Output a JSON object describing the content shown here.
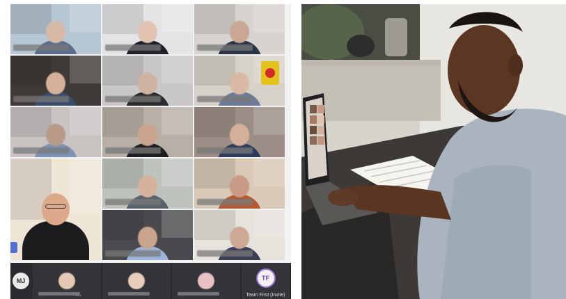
{
  "call": {
    "participants_bar": {
      "mj_initials": "MJ",
      "more_indicator": "...",
      "invited_initials": "TF",
      "invited_label": "Team First (Invite)"
    }
  },
  "colors": {
    "bar_background": "#2b2b2f",
    "invite_ring": "#8f6fd1"
  },
  "tiles": [
    {
      "bg": "#b7c6d3",
      "skin": "#d7b9a8",
      "shirt": "#5a6d8a"
    },
    {
      "bg": "#e4e3e6",
      "skin": "#e2c2b0",
      "shirt": "#1f1f26"
    },
    {
      "bg": "#d7d4cf",
      "skin": "#c9a793",
      "shirt": "#2b3446"
    },
    {
      "bg": "#3e3a37",
      "skin": "#d6b199",
      "shirt": "#3b4b6a"
    },
    {
      "bg": "#c9c7c8",
      "skin": "#cfb3a2",
      "shirt": "#2c2c30"
    },
    {
      "bg": "#d7d2c9",
      "skin": "#d8b9a4",
      "shirt": "#6e7c9a"
    },
    {
      "bg": "#c9c3c2",
      "skin": "#b79a88",
      "shirt": "#7d93b7"
    },
    {
      "bg": "#b8b0a6",
      "skin": "#caa48e",
      "shirt": "#1d1d22"
    },
    {
      "bg": "#9c8e86",
      "skin": "#d4b09b",
      "shirt": "#2d3a5d"
    },
    {
      "bg": "#efe5d6",
      "skin": "#dca98b",
      "shirt": "#1c1c1f"
    },
    {
      "bg": "#bfc3bd",
      "skin": "#d6b29d",
      "shirt": "#57626b"
    },
    {
      "bg": "#d9c9b6",
      "skin": "#c99a86",
      "shirt": "#b35a31"
    },
    {
      "bg": "#4a4a4e",
      "skin": "#c9a38c",
      "shirt": "#9db5db"
    },
    {
      "bg": "#e6e2dc",
      "skin": "#cda995",
      "shirt": "#3a3f55"
    }
  ]
}
